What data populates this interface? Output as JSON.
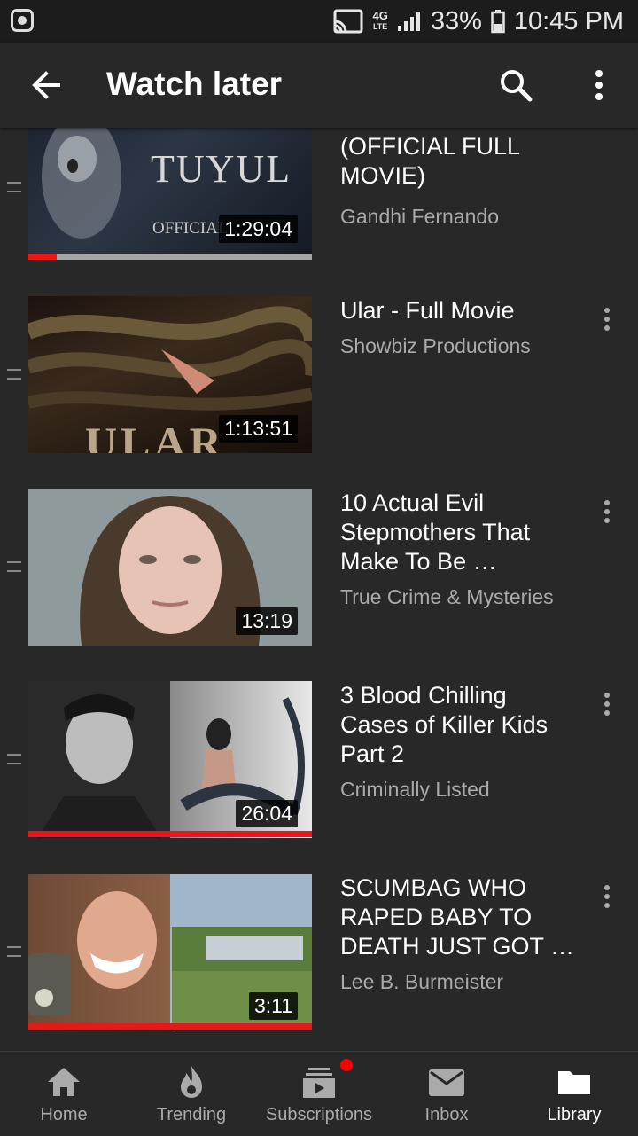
{
  "status_bar": {
    "network": "4G",
    "network_sub": "LTE",
    "battery": "33%",
    "time": "10:45 PM"
  },
  "app_bar": {
    "title": "Watch later"
  },
  "videos": [
    {
      "title": "(OFFICIAL FULL MOVIE)",
      "channel": "Gandhi Fernando",
      "duration": "1:29:04",
      "progress": 0.1,
      "thumb_text": "TUYUL",
      "thumb_subtext": "OFFICIAL"
    },
    {
      "title": "Ular - Full Movie",
      "channel": "Showbiz Productions",
      "duration": "1:13:51",
      "progress": null,
      "thumb_text": "ULAR"
    },
    {
      "title": "10 Actual Evil Stepmothers That Make To Be …",
      "channel": "True Crime & Mysteries",
      "duration": "13:19",
      "progress": null
    },
    {
      "title": "3 Blood Chilling Cases of Killer Kids Part 2",
      "channel": "Criminally Listed",
      "duration": "26:04",
      "progress": 1.0
    },
    {
      "title": "SCUMBAG WHO RAPED BABY TO DEATH JUST GOT …",
      "channel": "Lee B. Burmeister",
      "duration": "3:11",
      "progress": 1.0
    }
  ],
  "bottom_nav": [
    {
      "label": "Home",
      "icon": "home-icon"
    },
    {
      "label": "Trending",
      "icon": "flame-icon"
    },
    {
      "label": "Subscriptions",
      "icon": "subscriptions-icon"
    },
    {
      "label": "Inbox",
      "icon": "mail-icon"
    },
    {
      "label": "Library",
      "icon": "folder-icon",
      "active": true
    }
  ],
  "colors": {
    "background": "#282828",
    "progress_red": "#e41a1a",
    "text_secondary": "#aaaaaa"
  }
}
